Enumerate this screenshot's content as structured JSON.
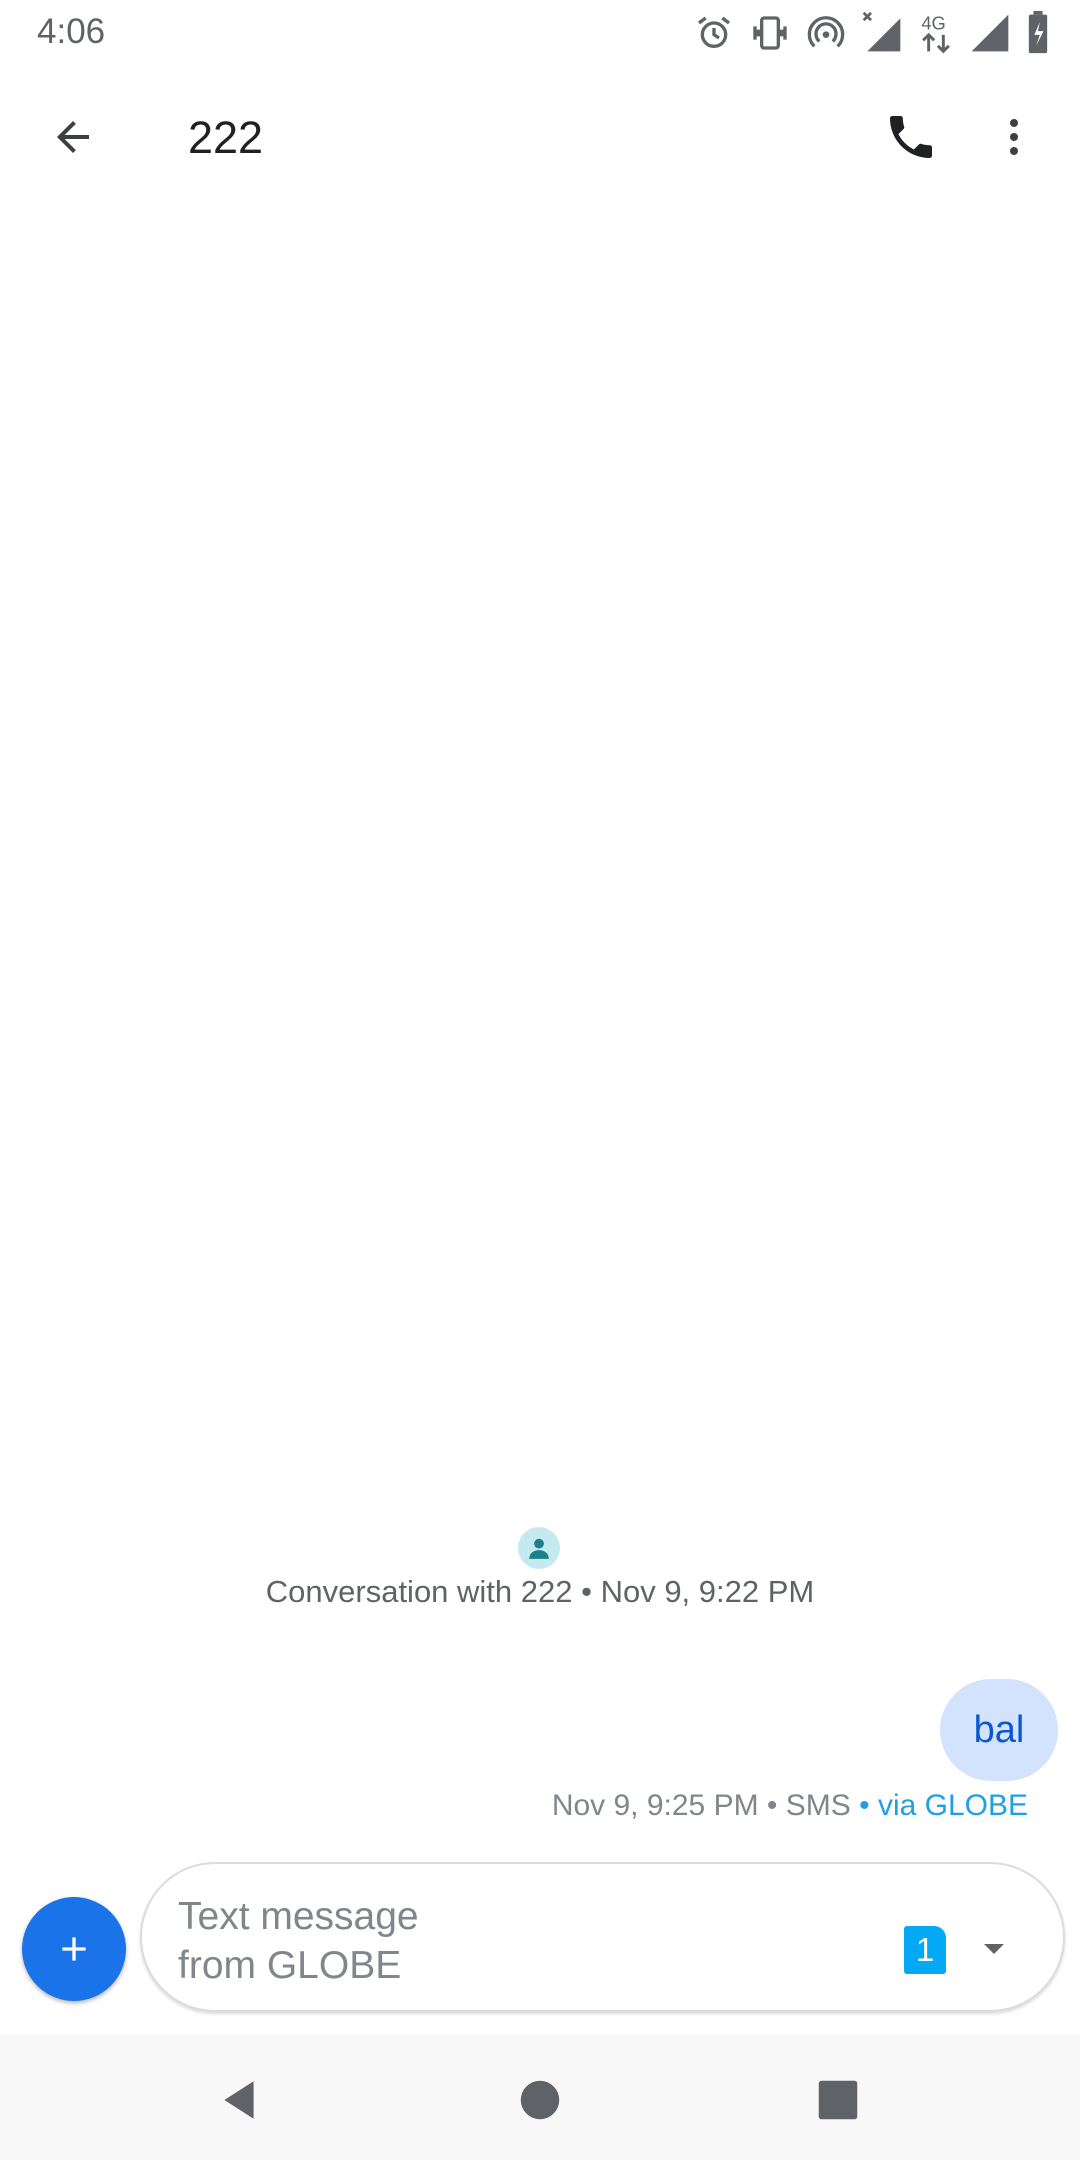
{
  "status_bar": {
    "time": "4:06",
    "icons": [
      "alarm-icon",
      "vibrate-icon",
      "hotspot-icon",
      "signal-no-data-icon",
      "4g-icon",
      "signal-icon",
      "battery-charging-icon"
    ],
    "network_label": "4G"
  },
  "app_bar": {
    "title": "222",
    "back_icon": "arrow-back-icon",
    "call_icon": "phone-icon",
    "more_icon": "more-vert-icon"
  },
  "conversation": {
    "info": "Conversation with 222 • Nov 9, 9:22 PM",
    "avatar_icon": "person-icon"
  },
  "messages": [
    {
      "text": "bal",
      "meta": "Nov 9, 9:25 PM • SMS",
      "via": " • via GLOBE"
    }
  ],
  "compose": {
    "placeholder": "Text message\nfrom GLOBE",
    "sim_number": "1",
    "attach_icon": "plus-icon",
    "dropdown_icon": "arrow-drop-down-icon"
  },
  "colors": {
    "accent": "#1a73e8",
    "bubble": "#d3e3fd",
    "bubble_text": "#0b57d0",
    "sim_badge": "#03a9f4",
    "via_text": "#1ea0e6"
  },
  "nav_bar": {
    "icons": [
      "nav-back-icon",
      "nav-home-icon",
      "nav-recents-icon"
    ]
  }
}
